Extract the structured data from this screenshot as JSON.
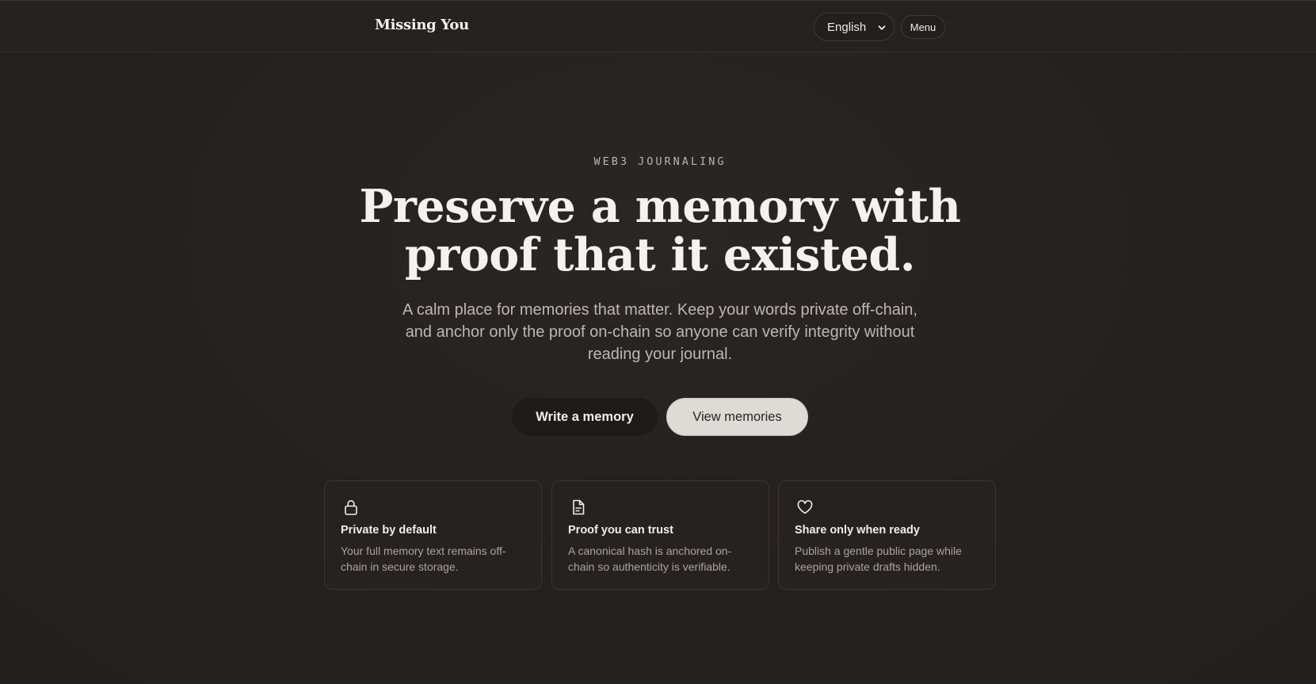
{
  "header": {
    "brand": "Missing You",
    "language": {
      "selected": "English"
    },
    "menu_label": "Menu"
  },
  "hero": {
    "eyebrow": "WEB3 JOURNALING",
    "headline_line1": "Preserve a memory with",
    "headline_line2": "proof that it existed.",
    "lede_line1": "A calm place for memories that matter. Keep your words private off-chain,",
    "lede_line2": "and anchor only the proof on-chain so anyone can verify integrity without",
    "lede_line3": "reading your journal.",
    "primary_cta": "Write a memory",
    "secondary_cta": "View memories"
  },
  "features": [
    {
      "icon": "lock-icon",
      "title": "Private by default",
      "body_line1": "Your full memory text remains off-",
      "body_line2": "chain in secure storage."
    },
    {
      "icon": "document-icon",
      "title": "Proof you can trust",
      "body_line1": "A canonical hash is anchored on-",
      "body_line2": "chain so authenticity is verifiable."
    },
    {
      "icon": "heart-icon",
      "title": "Share only when ready",
      "body_line1": "Publish a gentle public page while",
      "body_line2": "keeping private drafts hidden."
    }
  ],
  "colors": {
    "background": "#25211f",
    "text": "#f2efea",
    "muted": "#bdb7b0",
    "secondary_button": "#dedbd7"
  }
}
